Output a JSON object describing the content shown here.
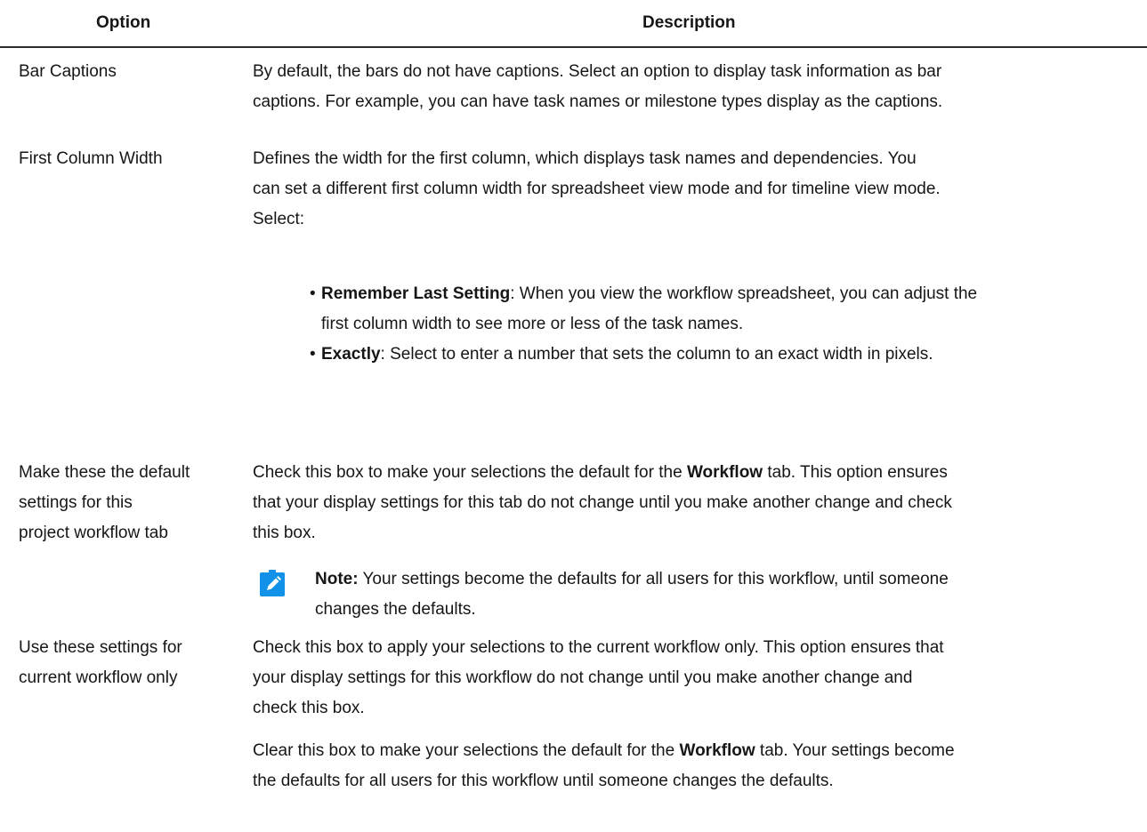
{
  "table": {
    "headers": {
      "option": "Option",
      "description": "Description"
    },
    "rows": [
      {
        "option": "Bar Captions",
        "description_lines": [
          "By default, the bars do not have captions. Select an option to display task information as bar",
          "captions. For example, you can have task names or milestone types display as the captions."
        ]
      },
      {
        "option": "First Column Width",
        "description_lines": [
          "Defines the width for the first column, which displays task names and dependencies. You",
          "can set a different first column width for spreadsheet view mode and for timeline view mode.",
          "Select:"
        ],
        "bullets": [
          {
            "term": "Remember Last Setting",
            "line1": ": When you view the workflow spreadsheet, you can adjust the",
            "line2": "first column width to see more or less of the task names."
          },
          {
            "term": "Exactly",
            "line1": ": Select to enter a number that sets the column to an exact width in pixels."
          }
        ]
      },
      {
        "option_lines": [
          "Make these the default",
          "settings for this",
          "project workflow tab"
        ],
        "desc_line1_pre": "Check this box to make your selections the default for the ",
        "desc_line1_bold": "Workflow",
        "desc_line1_post": " tab. This option ensures",
        "desc_line2": "that your display settings for this tab do not change until you make another change and check",
        "desc_line3": "this box.",
        "note": {
          "label": "Note:",
          "line1": " Your settings become the defaults for all users for this workflow, until someone",
          "line2": "changes the defaults.",
          "icon_color": "#1192e8"
        }
      },
      {
        "option_lines": [
          "Use these settings for",
          "current workflow only"
        ],
        "description_lines": [
          "Check this box to apply your selections to the current workflow only. This option ensures that",
          "your display settings for this workflow do not change until you make another change and",
          "check this box."
        ],
        "para2_line1_pre": "Clear this box to make your selections the default for the ",
        "para2_line1_bold": "Workflow",
        "para2_line1_post": " tab. Your settings become",
        "para2_line2": "the defaults for all users for this workflow until someone changes the defaults."
      }
    ]
  }
}
